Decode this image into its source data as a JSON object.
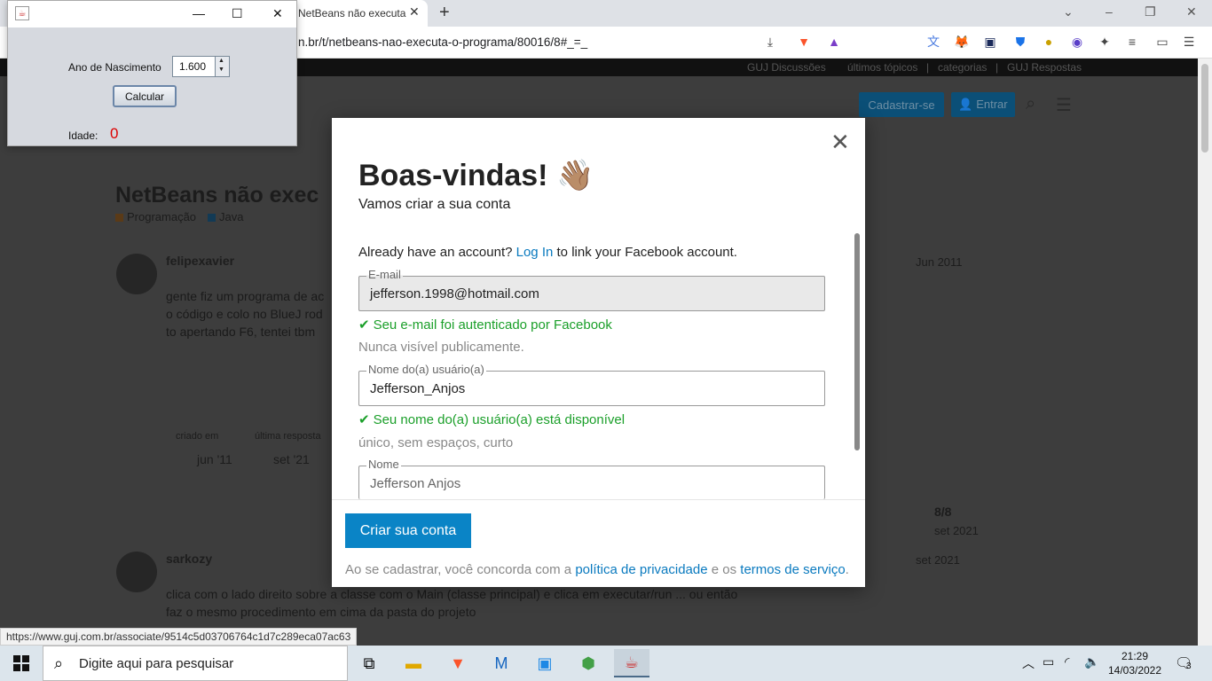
{
  "browser": {
    "tab_title": "NetBeans não executa o programa",
    "tab_close": "✕",
    "new_tab": "+",
    "url": "n.br/t/netbeans-nao-executa-o-programa/80016/8#_=_",
    "status_url": "https://www.guj.com.br/associate/9514c5d03706764c1d7c289eca07ac63",
    "window_controls": {
      "minimize": "⌄",
      "min": "–",
      "restore": "❐",
      "close": "✕"
    }
  },
  "page": {
    "topnav": [
      "GUJ Discussões",
      "últimos tópicos",
      "|",
      "categorias",
      "|",
      "GUJ Respostas"
    ],
    "signup_label": "Cadastrar-se",
    "login_label": "👤 Entrar",
    "title": "NetBeans não exec",
    "categories": [
      "Programação",
      "Java"
    ],
    "post1": {
      "user": "felipexavier",
      "date": "Jun 2011",
      "lines": [
        "gente fiz um programa de ac",
        "o código e colo no BlueJ rod",
        "to apertando F6, tentei tbm"
      ]
    },
    "summary": {
      "created_label": "criado em",
      "last_reply_label": "última resposta",
      "created_date": "jun '11",
      "last_date": "set '21"
    },
    "progress": {
      "count": "8/8",
      "date": "set 2021"
    },
    "post2": {
      "user": "sarkozy",
      "date": "set 2021",
      "lines": [
        "clica com o lado direito sobre a classe com o Main (classe principal) e clica em executar/run ... ou então",
        "faz o mesmo procedimento em cima da pasta do projeto"
      ]
    }
  },
  "modal": {
    "close": "✕",
    "title": "Boas-vindas! 👋🏽",
    "subtitle": "Vamos criar a sua conta",
    "already_prefix": "Already have an account?",
    "login_link": "Log In",
    "already_suffix": "to link your Facebook account.",
    "email": {
      "label": "E-mail",
      "value": "jefferson.1998@hotmail.com",
      "ok": "Seu e-mail foi autenticado por Facebook",
      "hint": "Nunca visível publicamente."
    },
    "username": {
      "label": "Nome do(a) usuário(a)",
      "value": "Jefferson_Anjos",
      "ok": "Seu nome do(a) usuário(a) está disponível",
      "hint": "único, sem espaços, curto"
    },
    "name": {
      "label": "Nome",
      "value": "Jefferson Anjos"
    },
    "create_button": "Criar sua conta",
    "terms_prefix": "Ao se cadastrar, você concorda com a",
    "privacy_link": "política de privacidade",
    "terms_mid": "e os",
    "terms_link": "termos de serviço",
    "terms_suffix": "."
  },
  "java_app": {
    "birth_label": "Ano de Nascimento",
    "birth_value": "1.600",
    "calc_button": "Calcular",
    "age_label": "Idade:",
    "age_value": "0"
  },
  "taskbar": {
    "search_placeholder": "Digite aqui para pesquisar",
    "time": "21:29",
    "date": "14/03/2022",
    "notifications": "3"
  }
}
